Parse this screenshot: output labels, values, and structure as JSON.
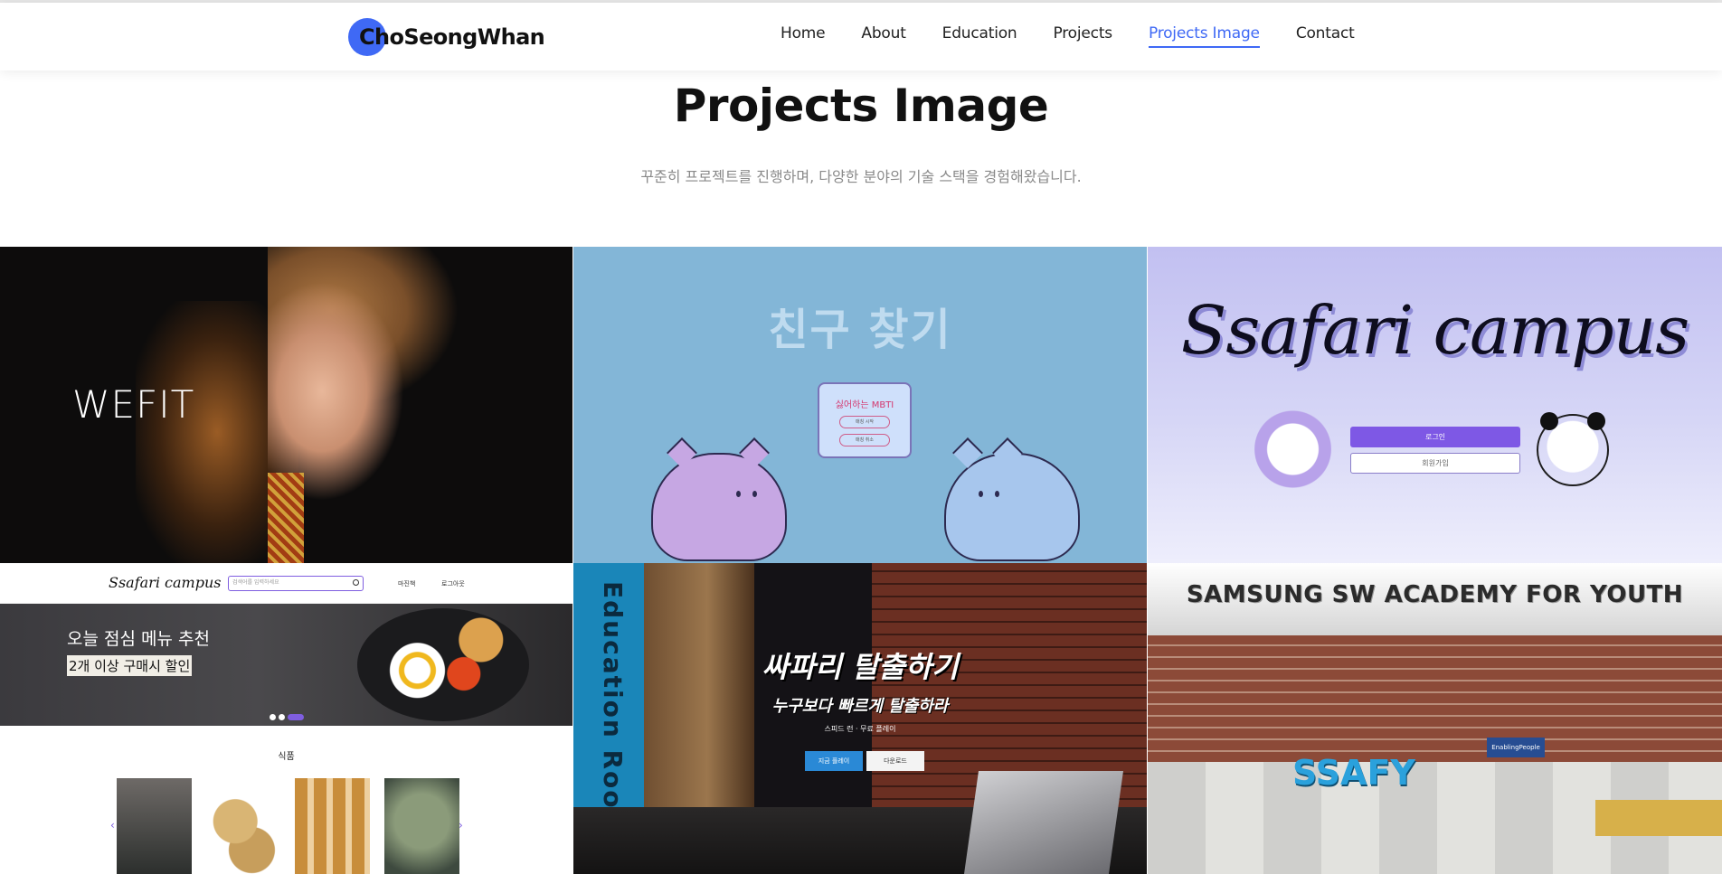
{
  "nav": {
    "logo": "ChoSeongWhan",
    "items": [
      {
        "label": "Home"
      },
      {
        "label": "About"
      },
      {
        "label": "Education"
      },
      {
        "label": "Projects"
      },
      {
        "label": "Projects Image",
        "active": true
      },
      {
        "label": "Contact"
      }
    ],
    "accent": "#3f69f5"
  },
  "section": {
    "title": "Projects Image",
    "subtitle": "꾸준히 프로젝트를 진행하며, 다양한 분야의 기술 스택을 경험해왔습니다."
  },
  "tiles": {
    "wefit": {
      "text": "WEFIT"
    },
    "friend": {
      "title": "친구 찾기",
      "card_title": "싫어하는 MBTI",
      "btn1": "매칭 시작",
      "btn2": "매칭 취소"
    },
    "ssafari": {
      "title": "Ssafari campus",
      "btn_login": "로그인",
      "btn_signup": "회원가입"
    },
    "shop": {
      "logo": "Ssafari campus",
      "search_placeholder": "검색어를 입력하세요",
      "link1": "마진책",
      "link2": "로그아웃",
      "banner_line1": "오늘 점심 메뉴 추천",
      "banner_line2": "2개 이상 구매시 할인",
      "category": "식품"
    },
    "escape": {
      "side_text": "Education Room",
      "title": "싸파리 탈출하기",
      "subtitle": "누구보다 빠르게 탈출하라",
      "small": "스피드 런 · 무료 플레이",
      "btn1": "지금 플레이",
      "btn2": "다운로드"
    },
    "ssafy": {
      "banner": "SAMSUNG SW ACADEMY FOR YOUTH",
      "sign": "SSAFY",
      "sub_sign": "EnablingPeople"
    }
  }
}
